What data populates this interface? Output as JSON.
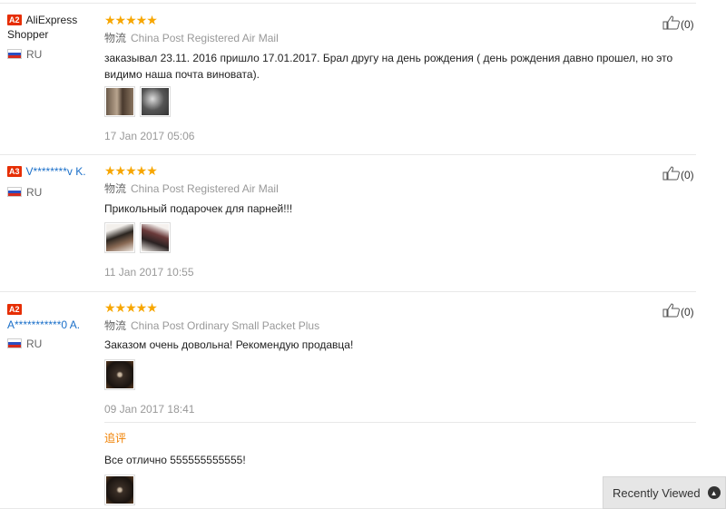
{
  "reviews": [
    {
      "level": "A2",
      "name": "AliExpress Shopper",
      "country": "RU",
      "stars": "★★★★★",
      "ship_cn": "物流",
      "shipping": "China Post Registered Air Mail",
      "text": "заказывал 23.11. 2016 пришло 17.01.2017. Брал другу на день рождения ( день рождения давно прошел, но это видимо наша почта виновата).",
      "date": "17 Jan 2017 05:06",
      "likes": "(0)"
    },
    {
      "level": "A3",
      "name": "V********v K.",
      "country": "RU",
      "stars": "★★★★★",
      "ship_cn": "物流",
      "shipping": "China Post Registered Air Mail",
      "text": "Прикольный подарочек для парней!!!",
      "date": "11 Jan 2017 10:55",
      "likes": "(0)"
    },
    {
      "level": "A2",
      "name": "A***********0 A.",
      "country": "RU",
      "stars": "★★★★★",
      "ship_cn": "物流",
      "shipping": "China Post Ordinary Small Packet Plus",
      "text": "Заказом очень довольна! Рекомендую продавца!",
      "date": "09 Jan 2017 18:41",
      "likes": "(0)",
      "followup_label": "追评",
      "followup_text": "Все отлично 555555555555!"
    }
  ],
  "recently_viewed": {
    "label": "Recently Viewed",
    "icon": "chevron-up-icon"
  },
  "colors": {
    "star": "#f7a600",
    "level_badge": "#e62e04",
    "link": "#1a6fc9",
    "followup": "#f08000"
  }
}
